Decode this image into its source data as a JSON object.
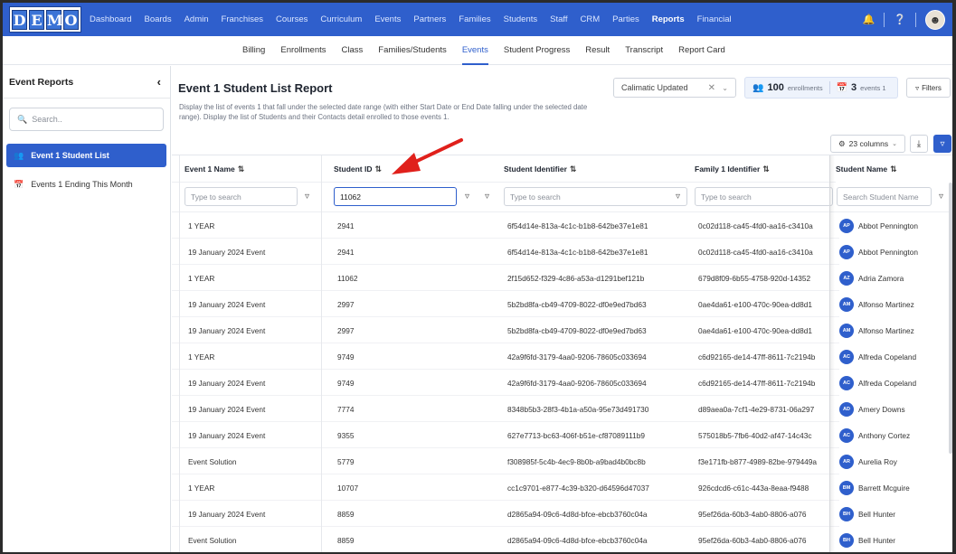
{
  "nav": {
    "logo_letters": [
      "D",
      "E",
      "M",
      "O"
    ],
    "links": [
      "Dashboard",
      "Boards",
      "Admin",
      "Franchises",
      "Courses",
      "Curriculum",
      "Events",
      "Partners",
      "Families",
      "Students",
      "Staff",
      "CRM",
      "Parties",
      "Reports",
      "Financial"
    ],
    "active": "Reports"
  },
  "subnav": {
    "links": [
      "Billing",
      "Enrollments",
      "Class",
      "Families/Students",
      "Events",
      "Student Progress",
      "Result",
      "Transcript",
      "Report Card"
    ],
    "active": "Events"
  },
  "sidebar": {
    "title": "Event Reports",
    "search_placeholder": "Search..",
    "items": [
      {
        "label": "Event 1 Student List",
        "active": true
      },
      {
        "label": "Events 1 Ending This Month",
        "active": false
      }
    ]
  },
  "main": {
    "title": "Event 1 Student List Report",
    "description": "Display the list of events 1 that fall under the selected date range (with either Start Date or End Date falling under the selected date range). Display the list of Students and their Contacts detail enrolled to those events 1.",
    "select_value": "Calimatic Updated",
    "enrollments_count": "100",
    "enrollments_label": "enrollments",
    "events_count": "3",
    "events_label": "events 1",
    "filters_label": "Filters",
    "columns_label": "23 columns"
  },
  "table": {
    "headers": [
      "Event 1 Name",
      "Student ID",
      "Student Identifier",
      "Family 1 Identifier",
      "Student Name"
    ],
    "filters": {
      "event_placeholder": "Type to search",
      "student_id_value": "11062",
      "identifier_placeholder": "Type to search",
      "family_placeholder": "Type to search",
      "name_placeholder": "Search Student Name"
    },
    "rows": [
      {
        "event": "1 YEAR",
        "id": "2941",
        "sid": "6f54d14e-813a-4c1c-b1b8-642be37e1e81",
        "fid": "0c02d118-ca45-4fd0-aa16-c3410a",
        "initials": "AP",
        "name": "Abbot Pennington"
      },
      {
        "event": "19 January 2024 Event",
        "id": "2941",
        "sid": "6f54d14e-813a-4c1c-b1b8-642be37e1e81",
        "fid": "0c02d118-ca45-4fd0-aa16-c3410a",
        "initials": "AP",
        "name": "Abbot Pennington"
      },
      {
        "event": "1 YEAR",
        "id": "11062",
        "sid": "2f15d652-f329-4c86-a53a-d1291bef121b",
        "fid": "679d8f09-6b55-4758-920d-14352",
        "initials": "AZ",
        "name": "Adria Zamora"
      },
      {
        "event": "19 January 2024 Event",
        "id": "2997",
        "sid": "5b2bd8fa-cb49-4709-8022-df0e9ed7bd63",
        "fid": "0ae4da61-e100-470c-90ea-dd8d1",
        "initials": "AM",
        "name": "Alfonso Martinez"
      },
      {
        "event": "19 January 2024 Event",
        "id": "2997",
        "sid": "5b2bd8fa-cb49-4709-8022-df0e9ed7bd63",
        "fid": "0ae4da61-e100-470c-90ea-dd8d1",
        "initials": "AM",
        "name": "Alfonso Martinez"
      },
      {
        "event": "1 YEAR",
        "id": "9749",
        "sid": "42a9f6fd-3179-4aa0-9206-78605c033694",
        "fid": "c6d92165-de14-47ff-8611-7c2194b",
        "initials": "AC",
        "name": "Alfreda Copeland"
      },
      {
        "event": "19 January 2024 Event",
        "id": "9749",
        "sid": "42a9f6fd-3179-4aa0-9206-78605c033694",
        "fid": "c6d92165-de14-47ff-8611-7c2194b",
        "initials": "AC",
        "name": "Alfreda Copeland"
      },
      {
        "event": "19 January 2024 Event",
        "id": "7774",
        "sid": "8348b5b3-28f3-4b1a-a50a-95e73d491730",
        "fid": "d89aea0a-7cf1-4e29-8731-06a297",
        "initials": "AD",
        "name": "Amery Downs"
      },
      {
        "event": "19 January 2024 Event",
        "id": "9355",
        "sid": "627e7713-bc63-406f-b51e-cf87089111b9",
        "fid": "575018b5-7fb6-40d2-af47-14c43c",
        "initials": "AC",
        "name": "Anthony Cortez"
      },
      {
        "event": "Event Solution",
        "id": "5779",
        "sid": "f308985f-5c4b-4ec9-8b0b-a9bad4b0bc8b",
        "fid": "f3e171fb-b877-4989-82be-979449a",
        "initials": "AR",
        "name": "Aurelia Roy"
      },
      {
        "event": "1 YEAR",
        "id": "10707",
        "sid": "cc1c9701-e877-4c39-b320-d64596d47037",
        "fid": "926cdcd6-c61c-443a-8eaa-f9488",
        "initials": "BM",
        "name": "Barrett Mcguire"
      },
      {
        "event": "19 January 2024 Event",
        "id": "8859",
        "sid": "d2865a94-09c6-4d8d-bfce-ebcb3760c04a",
        "fid": "95ef26da-60b3-4ab0-8806-a076",
        "initials": "BH",
        "name": "Bell Hunter"
      },
      {
        "event": "Event Solution",
        "id": "8859",
        "sid": "d2865a94-09c6-4d8d-bfce-ebcb3760c04a",
        "fid": "95ef26da-60b3-4ab0-8806-a076",
        "initials": "BH",
        "name": "Bell Hunter"
      }
    ]
  },
  "colors": {
    "primary": "#2f5fcc",
    "annotation_arrow": "#e0201b"
  }
}
